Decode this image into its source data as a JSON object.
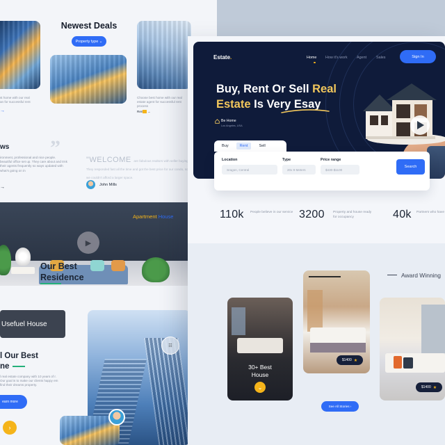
{
  "background_page": {
    "newest_deals_title": "Newest Deals",
    "property_type_button": "Property type",
    "left_snippet_1": "st home with our real\nan for successful rent",
    "left_snippet_link": "→",
    "right_snippet": "Choose best home with our real estate agent for successful rent process",
    "right_snippet_link": "Ren",
    "news_heading": "ws",
    "testimonial_left": "ironment, professional and nice people. beautiful office set up. They care about and trnk their agents frequently so ways updated with what's going on in",
    "welcome_word": "\"WELCOME",
    "welcome_text": "are fabulous realtors with seller buying. They responded fast all the time and got the best price for our condo, so we couldn't afford a larger space.",
    "author_name": "John Mills",
    "apartment_label": "Apartment",
    "apartment_label_2": "House",
    "useful_house": "Usefuel House",
    "our_best_title_1": "l Our Best",
    "our_best_title_2": "ne",
    "our_best_desc": "l real estate company with 10 years of r. Our goal is to make our clients happy em find their dreams property.",
    "learn_more_button": "earn more"
  },
  "header": {
    "logo": "Estate",
    "logo_dot": ".",
    "nav": [
      {
        "label": "Home"
      },
      {
        "label": "How it's work"
      },
      {
        "label": "Agent"
      },
      {
        "label": "Sales"
      }
    ],
    "signin_label": "Sign In"
  },
  "hero": {
    "headline_line1_a": "Buy, Rent Or Sell ",
    "headline_line1_b": "Real",
    "headline_line2_a": "Estate",
    "headline_line2_b": " Is Very Esay",
    "be_home": "Be Home",
    "be_home_location": "Los Angeles, USA"
  },
  "search": {
    "tabs": [
      {
        "label": "Buy"
      },
      {
        "label": "Rent"
      },
      {
        "label": "Sell"
      }
    ],
    "active_tab": "Rent",
    "location_label": "Location",
    "location_value": "Sragon, Central",
    "type_label": "Type",
    "type_value": "20x 9 Meters",
    "price_label": "Price range",
    "price_value": "$430-$1100",
    "search_button": "Search"
  },
  "stats": [
    {
      "number": "110k",
      "text": "People believe in our service"
    },
    {
      "number": "3200",
      "text": "Property and house ready for occupancy"
    },
    {
      "number": "40k",
      "text": "Partners who have worked with us"
    }
  ],
  "residence": {
    "title_line1": "Our Best",
    "title_line2": "Residence",
    "award": "Award Winning",
    "card1_label_line1": "30+ Best",
    "card1_label_line2": "House",
    "card2_price": "$1400",
    "card3_price": "$1400",
    "see_all": "See All Stories"
  },
  "colors": {
    "accent_blue": "#2f6cf6",
    "hero_navy": "#0f1b3a",
    "highlight_yellow": "#f2c75c",
    "star_yellow": "#f5b41a",
    "green": "#24b07a"
  }
}
